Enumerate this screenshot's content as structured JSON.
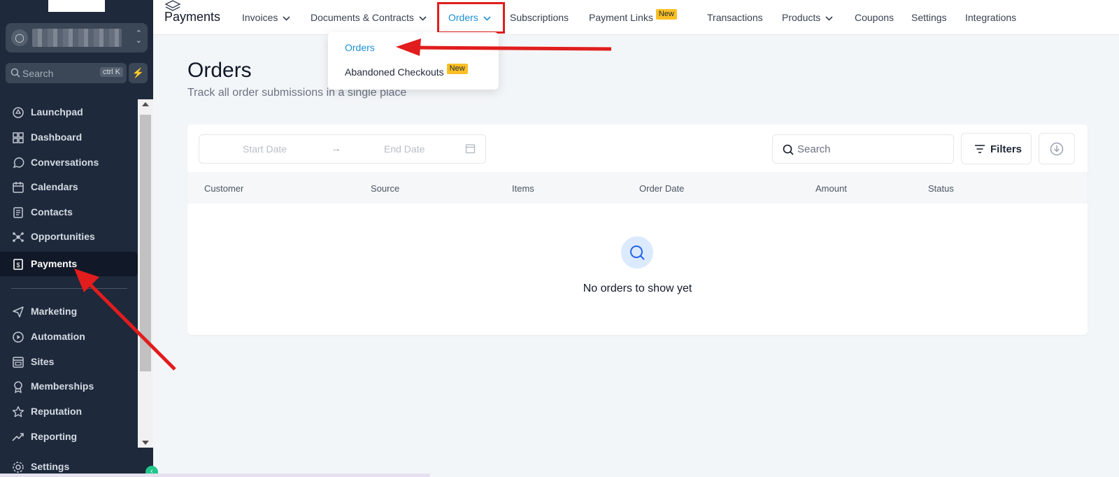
{
  "sidebar": {
    "search_placeholder": "Search",
    "search_shortcut": "ctrl K",
    "items": [
      {
        "label": "Launchpad",
        "icon": "rocket-icon"
      },
      {
        "label": "Dashboard",
        "icon": "grid-icon"
      },
      {
        "label": "Conversations",
        "icon": "chat-icon"
      },
      {
        "label": "Calendars",
        "icon": "calendar-icon"
      },
      {
        "label": "Contacts",
        "icon": "address-book-icon"
      },
      {
        "label": "Opportunities",
        "icon": "network-icon"
      },
      {
        "label": "Payments",
        "icon": "receipt-icon"
      },
      {
        "label": "Marketing",
        "icon": "send-icon"
      },
      {
        "label": "Automation",
        "icon": "automation-icon"
      },
      {
        "label": "Sites",
        "icon": "browser-icon"
      },
      {
        "label": "Memberships",
        "icon": "badge-icon"
      },
      {
        "label": "Reputation",
        "icon": "star-icon"
      },
      {
        "label": "Reporting",
        "icon": "trend-icon"
      },
      {
        "label": "Settings",
        "icon": "gear-icon"
      }
    ],
    "active_item": "Payments"
  },
  "topnav": {
    "brand": "Payments",
    "tabs": [
      {
        "label": "Invoices"
      },
      {
        "label": "Documents & Contracts"
      },
      {
        "label": "Orders"
      },
      {
        "label": "Subscriptions"
      },
      {
        "label": "Payment Links",
        "badge": "New"
      },
      {
        "label": "Transactions"
      },
      {
        "label": "Products"
      },
      {
        "label": "Coupons"
      },
      {
        "label": "Settings"
      },
      {
        "label": "Integrations"
      }
    ],
    "active_tab": "Orders"
  },
  "dropdown": {
    "items": [
      {
        "label": "Orders"
      },
      {
        "label": "Abandoned Checkouts",
        "badge": "New"
      }
    ]
  },
  "page": {
    "title": "Orders",
    "subtitle": "Track all order submissions in a single place"
  },
  "toolbar": {
    "start_date_placeholder": "Start Date",
    "end_date_placeholder": "End Date",
    "search_placeholder": "Search",
    "filters_label": "Filters"
  },
  "table": {
    "columns": [
      "Customer",
      "Source",
      "Items",
      "Order Date",
      "Amount",
      "Status"
    ],
    "empty_message": "No orders to show yet"
  },
  "colors": {
    "accent": "#1d8fd6",
    "sidebar_bg": "#1e293b",
    "annotation": "#e11d1d",
    "badge": "#fbbf24"
  }
}
